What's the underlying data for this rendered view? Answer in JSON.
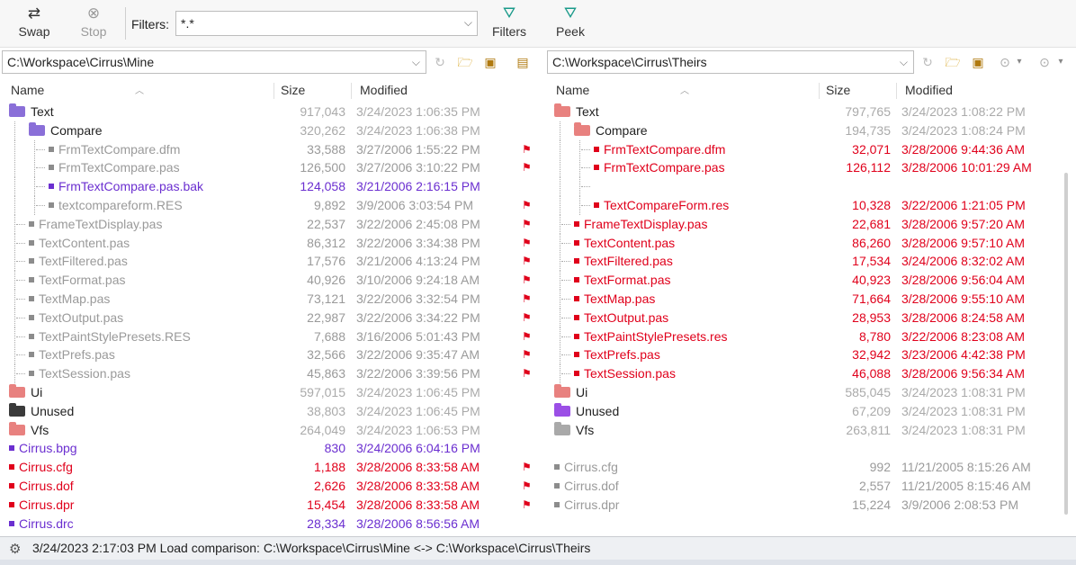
{
  "toolbar": {
    "swap_label": "Swap",
    "stop_label": "Stop",
    "filters_label": "Filters:",
    "filters_value": "*.*",
    "filters_button_label": "Filters",
    "peek_label": "Peek"
  },
  "paths": {
    "left": "C:\\Workspace\\Cirrus\\Mine",
    "right": "C:\\Workspace\\Cirrus\\Theirs"
  },
  "columns": {
    "name": "Name",
    "size": "Size",
    "modified": "Modified"
  },
  "left_rows": [
    {
      "name": "Text",
      "size": "917,043",
      "modified": "3/24/2023 1:06:35 PM",
      "indent": 0,
      "kind": "folder",
      "folder": "purple",
      "color": "black",
      "sizecolor": "gray"
    },
    {
      "name": "Compare",
      "size": "320,262",
      "modified": "3/24/2023 1:06:38 PM",
      "indent": 1,
      "kind": "folder",
      "folder": "purple",
      "color": "black",
      "sizecolor": "gray"
    },
    {
      "name": "FrmTextCompare.dfm",
      "size": "33,588",
      "modified": "3/27/2006 1:55:22 PM",
      "indent": 2,
      "kind": "file",
      "bullet": "gray",
      "color": "gray"
    },
    {
      "name": "FrmTextCompare.pas",
      "size": "126,500",
      "modified": "3/27/2006 3:10:22 PM",
      "indent": 2,
      "kind": "file",
      "bullet": "gray",
      "color": "gray"
    },
    {
      "name": "FrmTextCompare.pas.bak",
      "size": "124,058",
      "modified": "3/21/2006 2:16:15 PM",
      "indent": 2,
      "kind": "file",
      "bullet": "purple",
      "color": "purple"
    },
    {
      "name": "textcompareform.RES",
      "size": "9,892",
      "modified": "3/9/2006 3:03:54 PM",
      "indent": 2,
      "kind": "file",
      "bullet": "gray",
      "color": "gray"
    },
    {
      "name": "FrameTextDisplay.pas",
      "size": "22,537",
      "modified": "3/22/2006 2:45:08 PM",
      "indent": 1,
      "kind": "file",
      "bullet": "gray",
      "color": "gray"
    },
    {
      "name": "TextContent.pas",
      "size": "86,312",
      "modified": "3/22/2006 3:34:38 PM",
      "indent": 1,
      "kind": "file",
      "bullet": "gray",
      "color": "gray"
    },
    {
      "name": "TextFiltered.pas",
      "size": "17,576",
      "modified": "3/21/2006 4:13:24 PM",
      "indent": 1,
      "kind": "file",
      "bullet": "gray",
      "color": "gray"
    },
    {
      "name": "TextFormat.pas",
      "size": "40,926",
      "modified": "3/10/2006 9:24:18 AM",
      "indent": 1,
      "kind": "file",
      "bullet": "gray",
      "color": "gray"
    },
    {
      "name": "TextMap.pas",
      "size": "73,121",
      "modified": "3/22/2006 3:32:54 PM",
      "indent": 1,
      "kind": "file",
      "bullet": "gray",
      "color": "gray"
    },
    {
      "name": "TextOutput.pas",
      "size": "22,987",
      "modified": "3/22/2006 3:34:22 PM",
      "indent": 1,
      "kind": "file",
      "bullet": "gray",
      "color": "gray"
    },
    {
      "name": "TextPaintStylePresets.RES",
      "size": "7,688",
      "modified": "3/16/2006 5:01:43 PM",
      "indent": 1,
      "kind": "file",
      "bullet": "gray",
      "color": "gray"
    },
    {
      "name": "TextPrefs.pas",
      "size": "32,566",
      "modified": "3/22/2006 9:35:47 AM",
      "indent": 1,
      "kind": "file",
      "bullet": "gray",
      "color": "gray"
    },
    {
      "name": "TextSession.pas",
      "size": "45,863",
      "modified": "3/22/2006 3:39:56 PM",
      "indent": 1,
      "kind": "file",
      "bullet": "gray",
      "color": "gray"
    },
    {
      "name": "Ui",
      "size": "597,015",
      "modified": "3/24/2023 1:06:45 PM",
      "indent": 0,
      "kind": "folder",
      "folder": "red",
      "color": "black",
      "sizecolor": "gray"
    },
    {
      "name": "Unused",
      "size": "38,803",
      "modified": "3/24/2023 1:06:45 PM",
      "indent": 0,
      "kind": "folder",
      "folder": "black",
      "color": "black",
      "sizecolor": "gray"
    },
    {
      "name": "Vfs",
      "size": "264,049",
      "modified": "3/24/2023 1:06:53 PM",
      "indent": 0,
      "kind": "folder",
      "folder": "red",
      "color": "black",
      "sizecolor": "gray"
    },
    {
      "name": "Cirrus.bpg",
      "size": "830",
      "modified": "3/24/2006 6:04:16 PM",
      "indent": 0,
      "kind": "file",
      "bullet": "purple",
      "color": "purple"
    },
    {
      "name": "Cirrus.cfg",
      "size": "1,188",
      "modified": "3/28/2006 8:33:58 AM",
      "indent": 0,
      "kind": "file",
      "bullet": "red",
      "color": "red"
    },
    {
      "name": "Cirrus.dof",
      "size": "2,626",
      "modified": "3/28/2006 8:33:58 AM",
      "indent": 0,
      "kind": "file",
      "bullet": "red",
      "color": "red"
    },
    {
      "name": "Cirrus.dpr",
      "size": "15,454",
      "modified": "3/28/2006 8:33:58 AM",
      "indent": 0,
      "kind": "file",
      "bullet": "red",
      "color": "red"
    },
    {
      "name": "Cirrus.drc",
      "size": "28,334",
      "modified": "3/28/2006 8:56:56 AM",
      "indent": 0,
      "kind": "file",
      "bullet": "purple",
      "color": "purple"
    }
  ],
  "right_rows": [
    {
      "name": "Text",
      "size": "797,765",
      "modified": "3/24/2023 1:08:22 PM",
      "indent": 0,
      "kind": "folder",
      "folder": "red",
      "color": "black",
      "sizecolor": "gray"
    },
    {
      "name": "Compare",
      "size": "194,735",
      "modified": "3/24/2023 1:08:24 PM",
      "indent": 1,
      "kind": "folder",
      "folder": "red",
      "color": "black",
      "sizecolor": "gray"
    },
    {
      "name": "FrmTextCompare.dfm",
      "size": "32,071",
      "modified": "3/28/2006 9:44:36 AM",
      "indent": 2,
      "kind": "file",
      "bullet": "red",
      "color": "red"
    },
    {
      "name": "FrmTextCompare.pas",
      "size": "126,112",
      "modified": "3/28/2006 10:01:29 AM",
      "indent": 2,
      "kind": "file",
      "bullet": "red",
      "color": "red"
    },
    {
      "name": "",
      "size": "",
      "modified": "",
      "indent": 2,
      "kind": "blank"
    },
    {
      "name": "TextCompareForm.res",
      "size": "10,328",
      "modified": "3/22/2006 1:21:05 PM",
      "indent": 2,
      "kind": "file",
      "bullet": "red",
      "color": "red"
    },
    {
      "name": "FrameTextDisplay.pas",
      "size": "22,681",
      "modified": "3/28/2006 9:57:20 AM",
      "indent": 1,
      "kind": "file",
      "bullet": "red",
      "color": "red"
    },
    {
      "name": "TextContent.pas",
      "size": "86,260",
      "modified": "3/28/2006 9:57:10 AM",
      "indent": 1,
      "kind": "file",
      "bullet": "red",
      "color": "red"
    },
    {
      "name": "TextFiltered.pas",
      "size": "17,534",
      "modified": "3/24/2006 8:32:02 AM",
      "indent": 1,
      "kind": "file",
      "bullet": "red",
      "color": "red"
    },
    {
      "name": "TextFormat.pas",
      "size": "40,923",
      "modified": "3/28/2006 9:56:04 AM",
      "indent": 1,
      "kind": "file",
      "bullet": "red",
      "color": "red"
    },
    {
      "name": "TextMap.pas",
      "size": "71,664",
      "modified": "3/28/2006 9:55:10 AM",
      "indent": 1,
      "kind": "file",
      "bullet": "red",
      "color": "red"
    },
    {
      "name": "TextOutput.pas",
      "size": "28,953",
      "modified": "3/28/2006 8:24:58 AM",
      "indent": 1,
      "kind": "file",
      "bullet": "red",
      "color": "red"
    },
    {
      "name": "TextPaintStylePresets.res",
      "size": "8,780",
      "modified": "3/22/2006 8:23:08 AM",
      "indent": 1,
      "kind": "file",
      "bullet": "red",
      "color": "red"
    },
    {
      "name": "TextPrefs.pas",
      "size": "32,942",
      "modified": "3/23/2006 4:42:38 PM",
      "indent": 1,
      "kind": "file",
      "bullet": "red",
      "color": "red"
    },
    {
      "name": "TextSession.pas",
      "size": "46,088",
      "modified": "3/28/2006 9:56:34 AM",
      "indent": 1,
      "kind": "file",
      "bullet": "red",
      "color": "red"
    },
    {
      "name": "Ui",
      "size": "585,045",
      "modified": "3/24/2023 1:08:31 PM",
      "indent": 0,
      "kind": "folder",
      "folder": "red",
      "color": "black",
      "sizecolor": "gray"
    },
    {
      "name": "Unused",
      "size": "67,209",
      "modified": "3/24/2023 1:08:31 PM",
      "indent": 0,
      "kind": "folder",
      "folder": "lav",
      "color": "black",
      "sizecolor": "gray"
    },
    {
      "name": "Vfs",
      "size": "263,811",
      "modified": "3/24/2023 1:08:31 PM",
      "indent": 0,
      "kind": "folder",
      "folder": "gray",
      "color": "black",
      "sizecolor": "gray"
    },
    {
      "name": "",
      "size": "",
      "modified": "",
      "indent": 0,
      "kind": "blank"
    },
    {
      "name": "Cirrus.cfg",
      "size": "992",
      "modified": "11/21/2005 8:15:26 AM",
      "indent": 0,
      "kind": "file",
      "bullet": "gray",
      "color": "gray"
    },
    {
      "name": "Cirrus.dof",
      "size": "2,557",
      "modified": "11/21/2005 8:15:46 AM",
      "indent": 0,
      "kind": "file",
      "bullet": "gray",
      "color": "gray"
    },
    {
      "name": "Cirrus.dpr",
      "size": "15,224",
      "modified": "3/9/2006 2:08:53 PM",
      "indent": 0,
      "kind": "file",
      "bullet": "gray",
      "color": "gray"
    }
  ],
  "gutter_flags": [
    2,
    3,
    5,
    6,
    7,
    8,
    9,
    10,
    11,
    12,
    13,
    14,
    19,
    20,
    21
  ],
  "status": {
    "text": "3/24/2023 2:17:03 PM  Load comparison: C:\\Workspace\\Cirrus\\Mine <-> C:\\Workspace\\Cirrus\\Theirs"
  }
}
